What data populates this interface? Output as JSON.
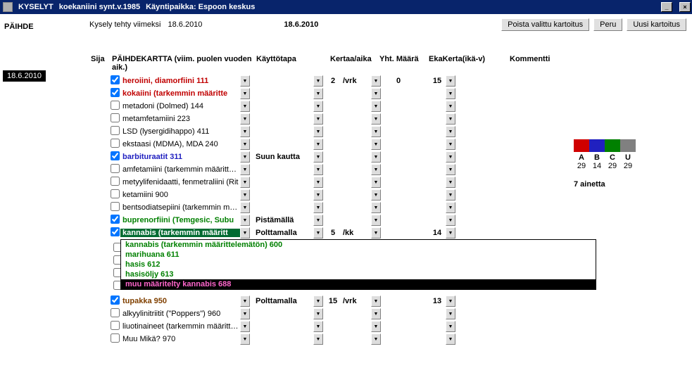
{
  "titlebar": {
    "app": "KYSELYT",
    "patient": "koekaniini synt.v.1985",
    "location_label": "Käyntipaikka: Espoon keskus"
  },
  "sidebar": {
    "section": "PÄIHDE",
    "selected_date": "18.6.2010"
  },
  "header": {
    "last_label": "Kysely tehty viimeksi",
    "last_date": "18.6.2010",
    "current_date": "18.6.2010",
    "btn_delete": "Poista valittu kartoitus",
    "btn_cancel": "Peru",
    "btn_new": "Uusi kartoitus"
  },
  "columns": {
    "sija": "Sija",
    "main": "PÄIHDEKARTTA (viim. puolen vuoden aik.)",
    "kaytto": "Käyttötapa",
    "kertaa": "Kertaa/aika",
    "maara": "Yht. Määrä",
    "eka": "EkaKerta(ikä-v)",
    "komm": "Kommentti"
  },
  "rows": [
    {
      "chk": true,
      "name": "heroiini, diamorfiini 111",
      "cls": "red",
      "kaytto": "",
      "kertaa": "2",
      "aika": "/vrk",
      "maara": "0",
      "eka": "15"
    },
    {
      "chk": true,
      "name": "kokaiini (tarkemmin määritte",
      "cls": "red",
      "kaytto": "",
      "kertaa": "",
      "aika": "",
      "maara": "",
      "eka": ""
    },
    {
      "chk": false,
      "name": "metadoni (Dolmed) 144",
      "cls": "",
      "kaytto": "",
      "kertaa": "",
      "aika": "",
      "maara": "",
      "eka": ""
    },
    {
      "chk": false,
      "name": "metamfetamiini 223",
      "cls": "",
      "kaytto": "",
      "kertaa": "",
      "aika": "",
      "maara": "",
      "eka": ""
    },
    {
      "chk": false,
      "name": "LSD (lysergidihappo) 411",
      "cls": "",
      "kaytto": "",
      "kertaa": "",
      "aika": "",
      "maara": "",
      "eka": ""
    },
    {
      "chk": false,
      "name": "ekstaasi (MDMA), MDA 240",
      "cls": "",
      "kaytto": "",
      "kertaa": "",
      "aika": "",
      "maara": "",
      "eka": ""
    },
    {
      "chk": true,
      "name": "barbituraatit 311",
      "cls": "blue",
      "kaytto": "Suun kautta",
      "kertaa": "",
      "aika": "",
      "maara": "",
      "eka": ""
    },
    {
      "chk": false,
      "name": "amfetamiini (tarkemmin määrittelem",
      "cls": "",
      "kaytto": "",
      "kertaa": "",
      "aika": "",
      "maara": "",
      "eka": ""
    },
    {
      "chk": false,
      "name": "metyylifenidaatti, fenmetraliini (Rit",
      "cls": "",
      "kaytto": "",
      "kertaa": "",
      "aika": "",
      "maara": "",
      "eka": ""
    },
    {
      "chk": false,
      "name": "ketamiini 900",
      "cls": "",
      "kaytto": "",
      "kertaa": "",
      "aika": "",
      "maara": "",
      "eka": ""
    },
    {
      "chk": false,
      "name": "bentsodiatsepiini (tarkemmin määri",
      "cls": "",
      "kaytto": "",
      "kertaa": "",
      "aika": "",
      "maara": "",
      "eka": ""
    },
    {
      "chk": true,
      "name": "buprenorfiini (Temgesic, Subu",
      "cls": "green",
      "kaytto": "Pistämällä",
      "kertaa": "",
      "aika": "",
      "maara": "",
      "eka": ""
    },
    {
      "chk": true,
      "name": "kannabis (tarkemmin määritt",
      "cls": "highlight",
      "kaytto": "Polttamalla",
      "kertaa": "5",
      "aika": "/kk",
      "maara": "",
      "eka": "14"
    },
    {
      "chk": true,
      "name": "tupakka 950",
      "cls": "brown",
      "kaytto": "Polttamalla",
      "kertaa": "15",
      "aika": "/vrk",
      "maara": "",
      "eka": "13"
    },
    {
      "chk": false,
      "name": "alkyylinitriitit (\"Poppers\") 960",
      "cls": "",
      "kaytto": "",
      "kertaa": "",
      "aika": "",
      "maara": "",
      "eka": ""
    },
    {
      "chk": false,
      "name": "liuotinaineet (tarkemmin määrittele",
      "cls": "",
      "kaytto": "",
      "kertaa": "",
      "aika": "",
      "maara": "",
      "eka": ""
    },
    {
      "chk": false,
      "name": "Muu  Mikä? 970",
      "cls": "",
      "kaytto": "",
      "kertaa": "",
      "aika": "",
      "maara": "",
      "eka": ""
    }
  ],
  "dropdown": {
    "after_row": 12,
    "side_checkboxes": 4,
    "items": [
      {
        "label": "kannabis (tarkemmin määrittelemätön) 600",
        "sel": false
      },
      {
        "label": "marihuana 611",
        "sel": false
      },
      {
        "label": "hasis 612",
        "sel": false
      },
      {
        "label": "hasisöljy 613",
        "sel": false
      },
      {
        "label": "muu määritelty kannabis 688",
        "sel": true
      }
    ]
  },
  "legend": {
    "labels": [
      "A",
      "B",
      "C",
      "U"
    ],
    "counts": [
      "29",
      "14",
      "29",
      "29"
    ],
    "summary": "7 ainetta"
  }
}
